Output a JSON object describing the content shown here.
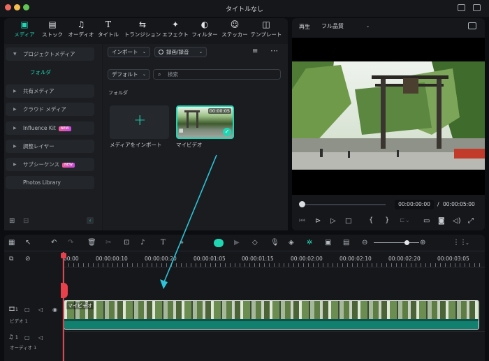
{
  "window": {
    "title": "タイトルなし"
  },
  "toolbar_tabs": [
    {
      "label": "メディア",
      "icon": "media-icon"
    },
    {
      "label": "ストック",
      "icon": "stock-icon"
    },
    {
      "label": "オーディオ",
      "icon": "audio-icon"
    },
    {
      "label": "タイトル",
      "icon": "title-icon"
    },
    {
      "label": "トランジション",
      "icon": "transition-icon"
    },
    {
      "label": "エフェクト",
      "icon": "effect-icon"
    },
    {
      "label": "フィルター",
      "icon": "filter-icon"
    },
    {
      "label": "ステッカー",
      "icon": "sticker-icon"
    },
    {
      "label": "テンプレート",
      "icon": "template-icon"
    }
  ],
  "sidebar": {
    "project_media": "プロジェクトメディア",
    "folder": "フォルダ",
    "items": [
      {
        "label": "共有メディア",
        "badge": ""
      },
      {
        "label": "クラウド メディア",
        "badge": ""
      },
      {
        "label": "Influence Kit",
        "badge": "NEW"
      },
      {
        "label": "調整レイヤー",
        "badge": ""
      },
      {
        "label": "サブシーケンス",
        "badge": "NEW"
      },
      {
        "label": "Photos Library",
        "badge": ""
      }
    ]
  },
  "media": {
    "import_label": "インポート",
    "record_label": "録画/録音",
    "sort_label": "デフォルト",
    "search_placeholder": "検索",
    "folder_heading": "フォルダ",
    "import_tile_label": "メディアをインポート",
    "clip_label": "マイビデオ",
    "clip_duration": "00:00:05"
  },
  "preview": {
    "play_label": "再生",
    "quality": "フル品質",
    "current_time": "00:00:00:00",
    "separator": "/",
    "total_time": "00:00:05:00",
    "progress": 0.0
  },
  "timeline": {
    "ruler": [
      "00:00",
      "00:00:00:10",
      "00:00:00:20",
      "00:00:01:05",
      "00:00:01:15",
      "00:00:02:00",
      "00:00:02:10",
      "00:00:02:20",
      "00:00:03:05"
    ],
    "video_track": "ビデオ 1",
    "audio_track": "オーディオ 1",
    "video_track_num": "1",
    "audio_track_num": "1",
    "clip_label": "マイビデオ"
  },
  "colors": {
    "accent": "#1fd6b3",
    "arrow": "#2bc4d8",
    "playhead": "#e8414b"
  }
}
